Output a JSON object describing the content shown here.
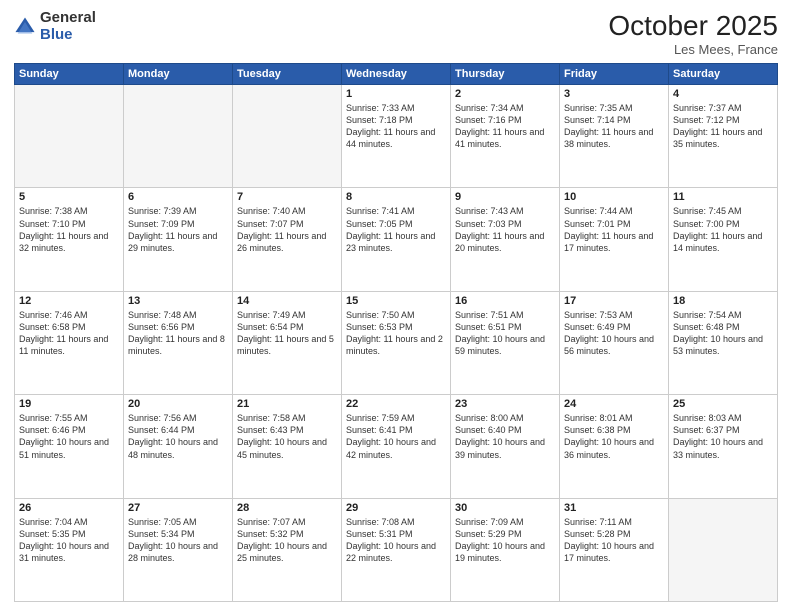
{
  "header": {
    "logo_general": "General",
    "logo_blue": "Blue",
    "title": "October 2025",
    "subtitle": "Les Mees, France"
  },
  "weekdays": [
    "Sunday",
    "Monday",
    "Tuesday",
    "Wednesday",
    "Thursday",
    "Friday",
    "Saturday"
  ],
  "weeks": [
    [
      {
        "day": "",
        "info": ""
      },
      {
        "day": "",
        "info": ""
      },
      {
        "day": "",
        "info": ""
      },
      {
        "day": "1",
        "info": "Sunrise: 7:33 AM\nSunset: 7:18 PM\nDaylight: 11 hours and 44 minutes."
      },
      {
        "day": "2",
        "info": "Sunrise: 7:34 AM\nSunset: 7:16 PM\nDaylight: 11 hours and 41 minutes."
      },
      {
        "day": "3",
        "info": "Sunrise: 7:35 AM\nSunset: 7:14 PM\nDaylight: 11 hours and 38 minutes."
      },
      {
        "day": "4",
        "info": "Sunrise: 7:37 AM\nSunset: 7:12 PM\nDaylight: 11 hours and 35 minutes."
      }
    ],
    [
      {
        "day": "5",
        "info": "Sunrise: 7:38 AM\nSunset: 7:10 PM\nDaylight: 11 hours and 32 minutes."
      },
      {
        "day": "6",
        "info": "Sunrise: 7:39 AM\nSunset: 7:09 PM\nDaylight: 11 hours and 29 minutes."
      },
      {
        "day": "7",
        "info": "Sunrise: 7:40 AM\nSunset: 7:07 PM\nDaylight: 11 hours and 26 minutes."
      },
      {
        "day": "8",
        "info": "Sunrise: 7:41 AM\nSunset: 7:05 PM\nDaylight: 11 hours and 23 minutes."
      },
      {
        "day": "9",
        "info": "Sunrise: 7:43 AM\nSunset: 7:03 PM\nDaylight: 11 hours and 20 minutes."
      },
      {
        "day": "10",
        "info": "Sunrise: 7:44 AM\nSunset: 7:01 PM\nDaylight: 11 hours and 17 minutes."
      },
      {
        "day": "11",
        "info": "Sunrise: 7:45 AM\nSunset: 7:00 PM\nDaylight: 11 hours and 14 minutes."
      }
    ],
    [
      {
        "day": "12",
        "info": "Sunrise: 7:46 AM\nSunset: 6:58 PM\nDaylight: 11 hours and 11 minutes."
      },
      {
        "day": "13",
        "info": "Sunrise: 7:48 AM\nSunset: 6:56 PM\nDaylight: 11 hours and 8 minutes."
      },
      {
        "day": "14",
        "info": "Sunrise: 7:49 AM\nSunset: 6:54 PM\nDaylight: 11 hours and 5 minutes."
      },
      {
        "day": "15",
        "info": "Sunrise: 7:50 AM\nSunset: 6:53 PM\nDaylight: 11 hours and 2 minutes."
      },
      {
        "day": "16",
        "info": "Sunrise: 7:51 AM\nSunset: 6:51 PM\nDaylight: 10 hours and 59 minutes."
      },
      {
        "day": "17",
        "info": "Sunrise: 7:53 AM\nSunset: 6:49 PM\nDaylight: 10 hours and 56 minutes."
      },
      {
        "day": "18",
        "info": "Sunrise: 7:54 AM\nSunset: 6:48 PM\nDaylight: 10 hours and 53 minutes."
      }
    ],
    [
      {
        "day": "19",
        "info": "Sunrise: 7:55 AM\nSunset: 6:46 PM\nDaylight: 10 hours and 51 minutes."
      },
      {
        "day": "20",
        "info": "Sunrise: 7:56 AM\nSunset: 6:44 PM\nDaylight: 10 hours and 48 minutes."
      },
      {
        "day": "21",
        "info": "Sunrise: 7:58 AM\nSunset: 6:43 PM\nDaylight: 10 hours and 45 minutes."
      },
      {
        "day": "22",
        "info": "Sunrise: 7:59 AM\nSunset: 6:41 PM\nDaylight: 10 hours and 42 minutes."
      },
      {
        "day": "23",
        "info": "Sunrise: 8:00 AM\nSunset: 6:40 PM\nDaylight: 10 hours and 39 minutes."
      },
      {
        "day": "24",
        "info": "Sunrise: 8:01 AM\nSunset: 6:38 PM\nDaylight: 10 hours and 36 minutes."
      },
      {
        "day": "25",
        "info": "Sunrise: 8:03 AM\nSunset: 6:37 PM\nDaylight: 10 hours and 33 minutes."
      }
    ],
    [
      {
        "day": "26",
        "info": "Sunrise: 7:04 AM\nSunset: 5:35 PM\nDaylight: 10 hours and 31 minutes."
      },
      {
        "day": "27",
        "info": "Sunrise: 7:05 AM\nSunset: 5:34 PM\nDaylight: 10 hours and 28 minutes."
      },
      {
        "day": "28",
        "info": "Sunrise: 7:07 AM\nSunset: 5:32 PM\nDaylight: 10 hours and 25 minutes."
      },
      {
        "day": "29",
        "info": "Sunrise: 7:08 AM\nSunset: 5:31 PM\nDaylight: 10 hours and 22 minutes."
      },
      {
        "day": "30",
        "info": "Sunrise: 7:09 AM\nSunset: 5:29 PM\nDaylight: 10 hours and 19 minutes."
      },
      {
        "day": "31",
        "info": "Sunrise: 7:11 AM\nSunset: 5:28 PM\nDaylight: 10 hours and 17 minutes."
      },
      {
        "day": "",
        "info": ""
      }
    ]
  ]
}
